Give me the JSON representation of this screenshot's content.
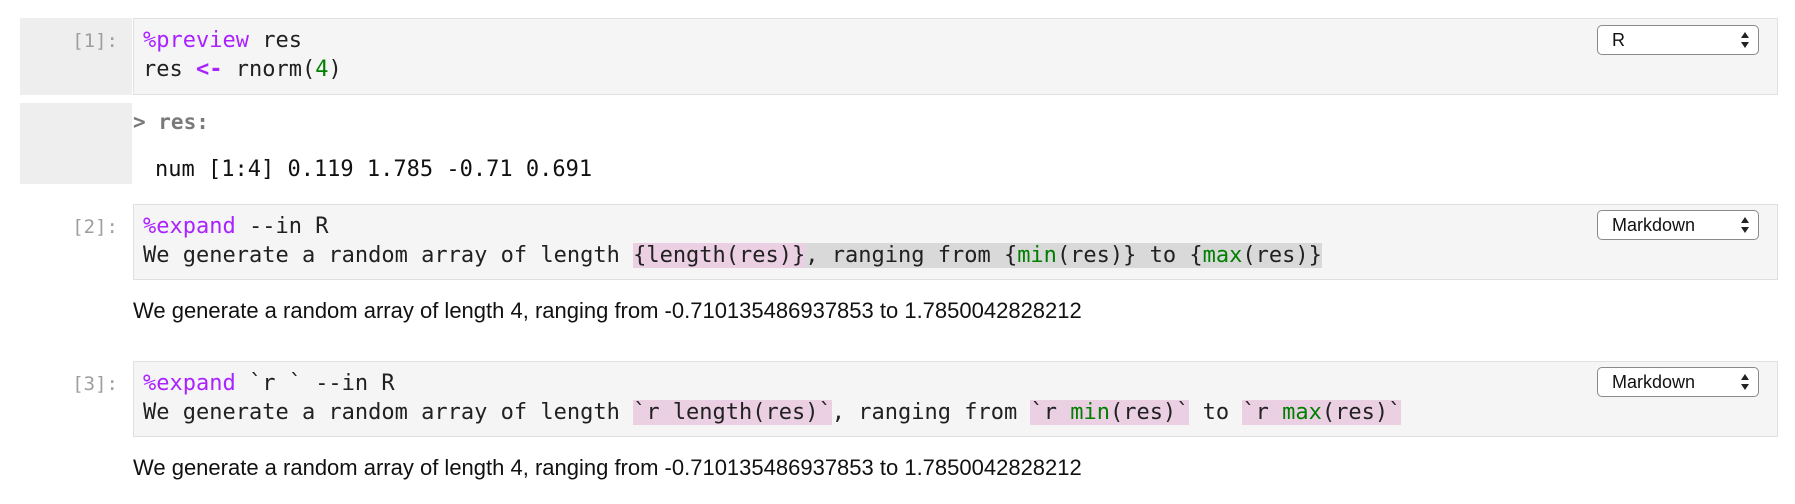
{
  "cells": [
    {
      "prompt": "[1]:",
      "kernel": "R",
      "line1_magic": "%preview",
      "line1_rest": " res",
      "line2_a": "res ",
      "line2_op": "<-",
      "line2_b": " rnorm(",
      "line2_num": "4",
      "line2_c": ")",
      "output": {
        "header": "> res:",
        "value": "num [1:4] 0.119 1.785 -0.71 0.691"
      }
    },
    {
      "prompt": "[2]:",
      "kernel": "Markdown",
      "line1_magic": "%expand",
      "line1_rest": " --in R",
      "line2_plain": "We generate a random array of length ",
      "line2_t1": "{length(res)}",
      "line2_t2": ", ranging from {",
      "line2_fn1": "min",
      "line2_t3": "(res)} to {",
      "line2_fn2": "max",
      "line2_t4": "(res)}",
      "output": "We generate a random array of length 4, ranging from -0.710135486937853 to 1.7850042828212"
    },
    {
      "prompt": "[3]:",
      "kernel": "Markdown",
      "line1_magic": "%expand",
      "line1_rest": " `r ` --in R",
      "line2_plain": "We generate a random array of length ",
      "line2_h1": "`r length(res)`",
      "line2_t1": ", ranging from ",
      "line2_h2a": "`r ",
      "line2_fn1": "min",
      "line2_h2b": "(res)`",
      "line2_t2": " to ",
      "line2_h3a": "`r ",
      "line2_fn2": "max",
      "line2_h3b": "(res)`",
      "output": "We generate a random array of length 4, ranging from -0.710135486937853 to 1.7850042828212"
    }
  ]
}
